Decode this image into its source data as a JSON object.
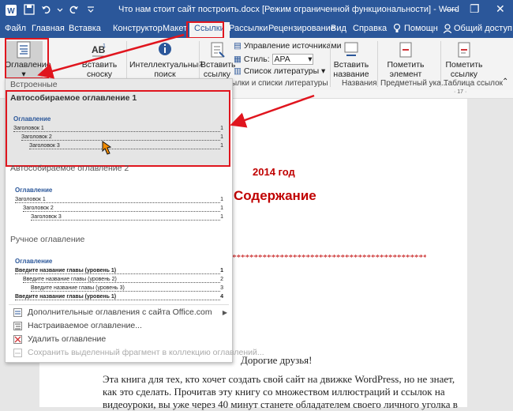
{
  "titlebar": {
    "title": "Что нам стоит сайт построить.docx [Режим ограниченной функциональности]  -  Word",
    "window_controls": [
      "—",
      "❐",
      "✕"
    ]
  },
  "tabs": [
    {
      "label": "Файл"
    },
    {
      "label": "Главная"
    },
    {
      "label": "Вставка"
    },
    {
      "label": "Конструктор"
    },
    {
      "label": "Макет"
    },
    {
      "label": "Ссылки",
      "active": true
    },
    {
      "label": "Рассылки"
    },
    {
      "label": "Рецензирование"
    },
    {
      "label": "Вид"
    },
    {
      "label": "Справка"
    },
    {
      "label": "Помощн"
    },
    {
      "label": "Общий доступ"
    }
  ],
  "ribbon": {
    "toc_button": "Оглавление",
    "footnote_line1": "Вставить",
    "footnote_line2": "сноску",
    "smart_lookup_line1": "Интеллектуальный",
    "smart_lookup_line2": "поиск",
    "citation_line1": "Вставить",
    "citation_line2": "ссылку",
    "manage_sources": "Управление источниками",
    "style_label": "Стиль:",
    "style_value": "APA",
    "bibliography": "Список литературы",
    "caption_line1": "Вставить",
    "caption_line2": "название",
    "mark_entry_line1": "Пометить",
    "mark_entry_line2": "элемент",
    "mark_citation_line1": "Пометить",
    "mark_citation_line2": "ссылку",
    "group_citations": "сылки и списки литературы",
    "group_captions": "Названия",
    "group_index": "Предметный ука...",
    "group_authorities": "Таблица ссылок"
  },
  "panel": {
    "builtin_header": "Встроенные",
    "auto1_header": "Автособираемое оглавление 1",
    "auto1": {
      "heading": "Оглавление",
      "lines": [
        {
          "text": "Заголовок 1",
          "page": "1"
        },
        {
          "text": "Заголовок 2",
          "page": "1"
        },
        {
          "text": "Заголовок 3",
          "page": "1"
        }
      ]
    },
    "auto2_header": "Автособираемое оглавление 2",
    "auto2": {
      "heading": "Оглавление",
      "lines": [
        {
          "text": "Заголовок 1",
          "page": "1"
        },
        {
          "text": "Заголовок 2",
          "page": "1"
        },
        {
          "text": "Заголовок 3",
          "page": "1"
        }
      ]
    },
    "manual_header": "Ручное оглавление",
    "manual": {
      "heading": "Оглавление",
      "lines": [
        {
          "text": "Введите название главы (уровень 1)",
          "page": "1"
        },
        {
          "text": "Введите название главы (уровень 2)",
          "page": "2"
        },
        {
          "text": "Введите название главы (уровень 3)",
          "page": "3"
        },
        {
          "text": "Введите название главы (уровень 1)",
          "page": "4"
        }
      ]
    },
    "menu": [
      {
        "label": "Дополнительные оглавления с сайта Office.com",
        "has_submenu": true,
        "enabled": true
      },
      {
        "label": "Настраиваемое оглавление...",
        "enabled": true
      },
      {
        "label": "Удалить оглавление",
        "enabled": true
      },
      {
        "label": "Сохранить выделенный фрагмент в коллекцию оглавлений...",
        "enabled": false
      }
    ]
  },
  "document": {
    "year": "2014 год",
    "contents_title": "Содержание",
    "stars": "***********************************************************",
    "greeting": "Дорогие друзья!",
    "para_line1": "Эта книга для тех, кто хочет создать свой сайт на движке WordPress, но не знает,",
    "para_line2": "как это сделать. Прочитав эту книгу со множеством иллюстраций и ссылок на",
    "para_line3": "видеоуроки, вы уже через 40 минут станете обладателем своего личного уголка в",
    "ruler_mark": "· 17 ·"
  },
  "colors": {
    "word_blue": "#2b579a",
    "annotation_red": "#e0151e",
    "doc_red": "#c00000"
  }
}
